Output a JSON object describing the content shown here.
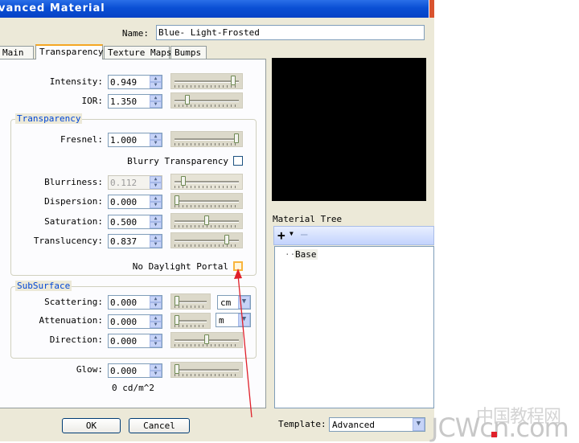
{
  "window": {
    "title": "vanced Material"
  },
  "name_field": {
    "label": "Name:",
    "value": "Blue- Light-Frosted"
  },
  "tabs": [
    {
      "label": "Main"
    },
    {
      "label": "Transparency"
    },
    {
      "label": "Texture Maps"
    },
    {
      "label": "Bumps"
    }
  ],
  "transparency_tab": {
    "intensity": {
      "label": "Intensity:",
      "value": "0.949",
      "level": 0.949
    },
    "ior": {
      "label": "IOR:",
      "value": "1.350",
      "level": 0.18
    },
    "group_transparency": {
      "title": "Transparency"
    },
    "fresnel": {
      "label": "Fresnel:",
      "value": "1.000",
      "level": 1.0
    },
    "blurry_transparency": {
      "label": "Blurry Transparency",
      "checked": false
    },
    "blurriness": {
      "label": "Blurriness:",
      "value": "0.112",
      "level": 0.112
    },
    "dispersion": {
      "label": "Dispersion:",
      "value": "0.000",
      "level": 0.0
    },
    "saturation": {
      "label": "Saturation:",
      "value": "0.500",
      "level": 0.5
    },
    "translucency": {
      "label": "Translucency:",
      "value": "0.837",
      "level": 0.837
    },
    "no_daylight_portal": {
      "label": "No Daylight Portal",
      "checked": false
    },
    "group_subsurface": {
      "title": "SubSurface"
    },
    "scattering": {
      "label": "Scattering:",
      "value": "0.000",
      "level": 0.0,
      "unit": "cm"
    },
    "attenuation": {
      "label": "Attenuation:",
      "value": "0.000",
      "level": 0.0,
      "unit": "m"
    },
    "direction": {
      "label": "Direction:",
      "value": "0.000",
      "level": 0.5
    },
    "glow": {
      "label": "Glow:",
      "value": "0.000",
      "level": 0.0
    },
    "glow_unit": "0 cd/m^2"
  },
  "material_tree": {
    "label": "Material Tree",
    "add_symbol": "+",
    "remove_symbol": "—",
    "root": "Base"
  },
  "template": {
    "label": "Template:",
    "value": "Advanced"
  },
  "buttons": {
    "ok": "OK",
    "cancel": "Cancel"
  },
  "watermark": {
    "text": "JCWcn.com",
    "cn_text": "中国教程网"
  },
  "colors": {
    "title_bar": "#0a4fd4",
    "group_title": "#0046d5",
    "annotation_arrow": "#e0202a"
  }
}
